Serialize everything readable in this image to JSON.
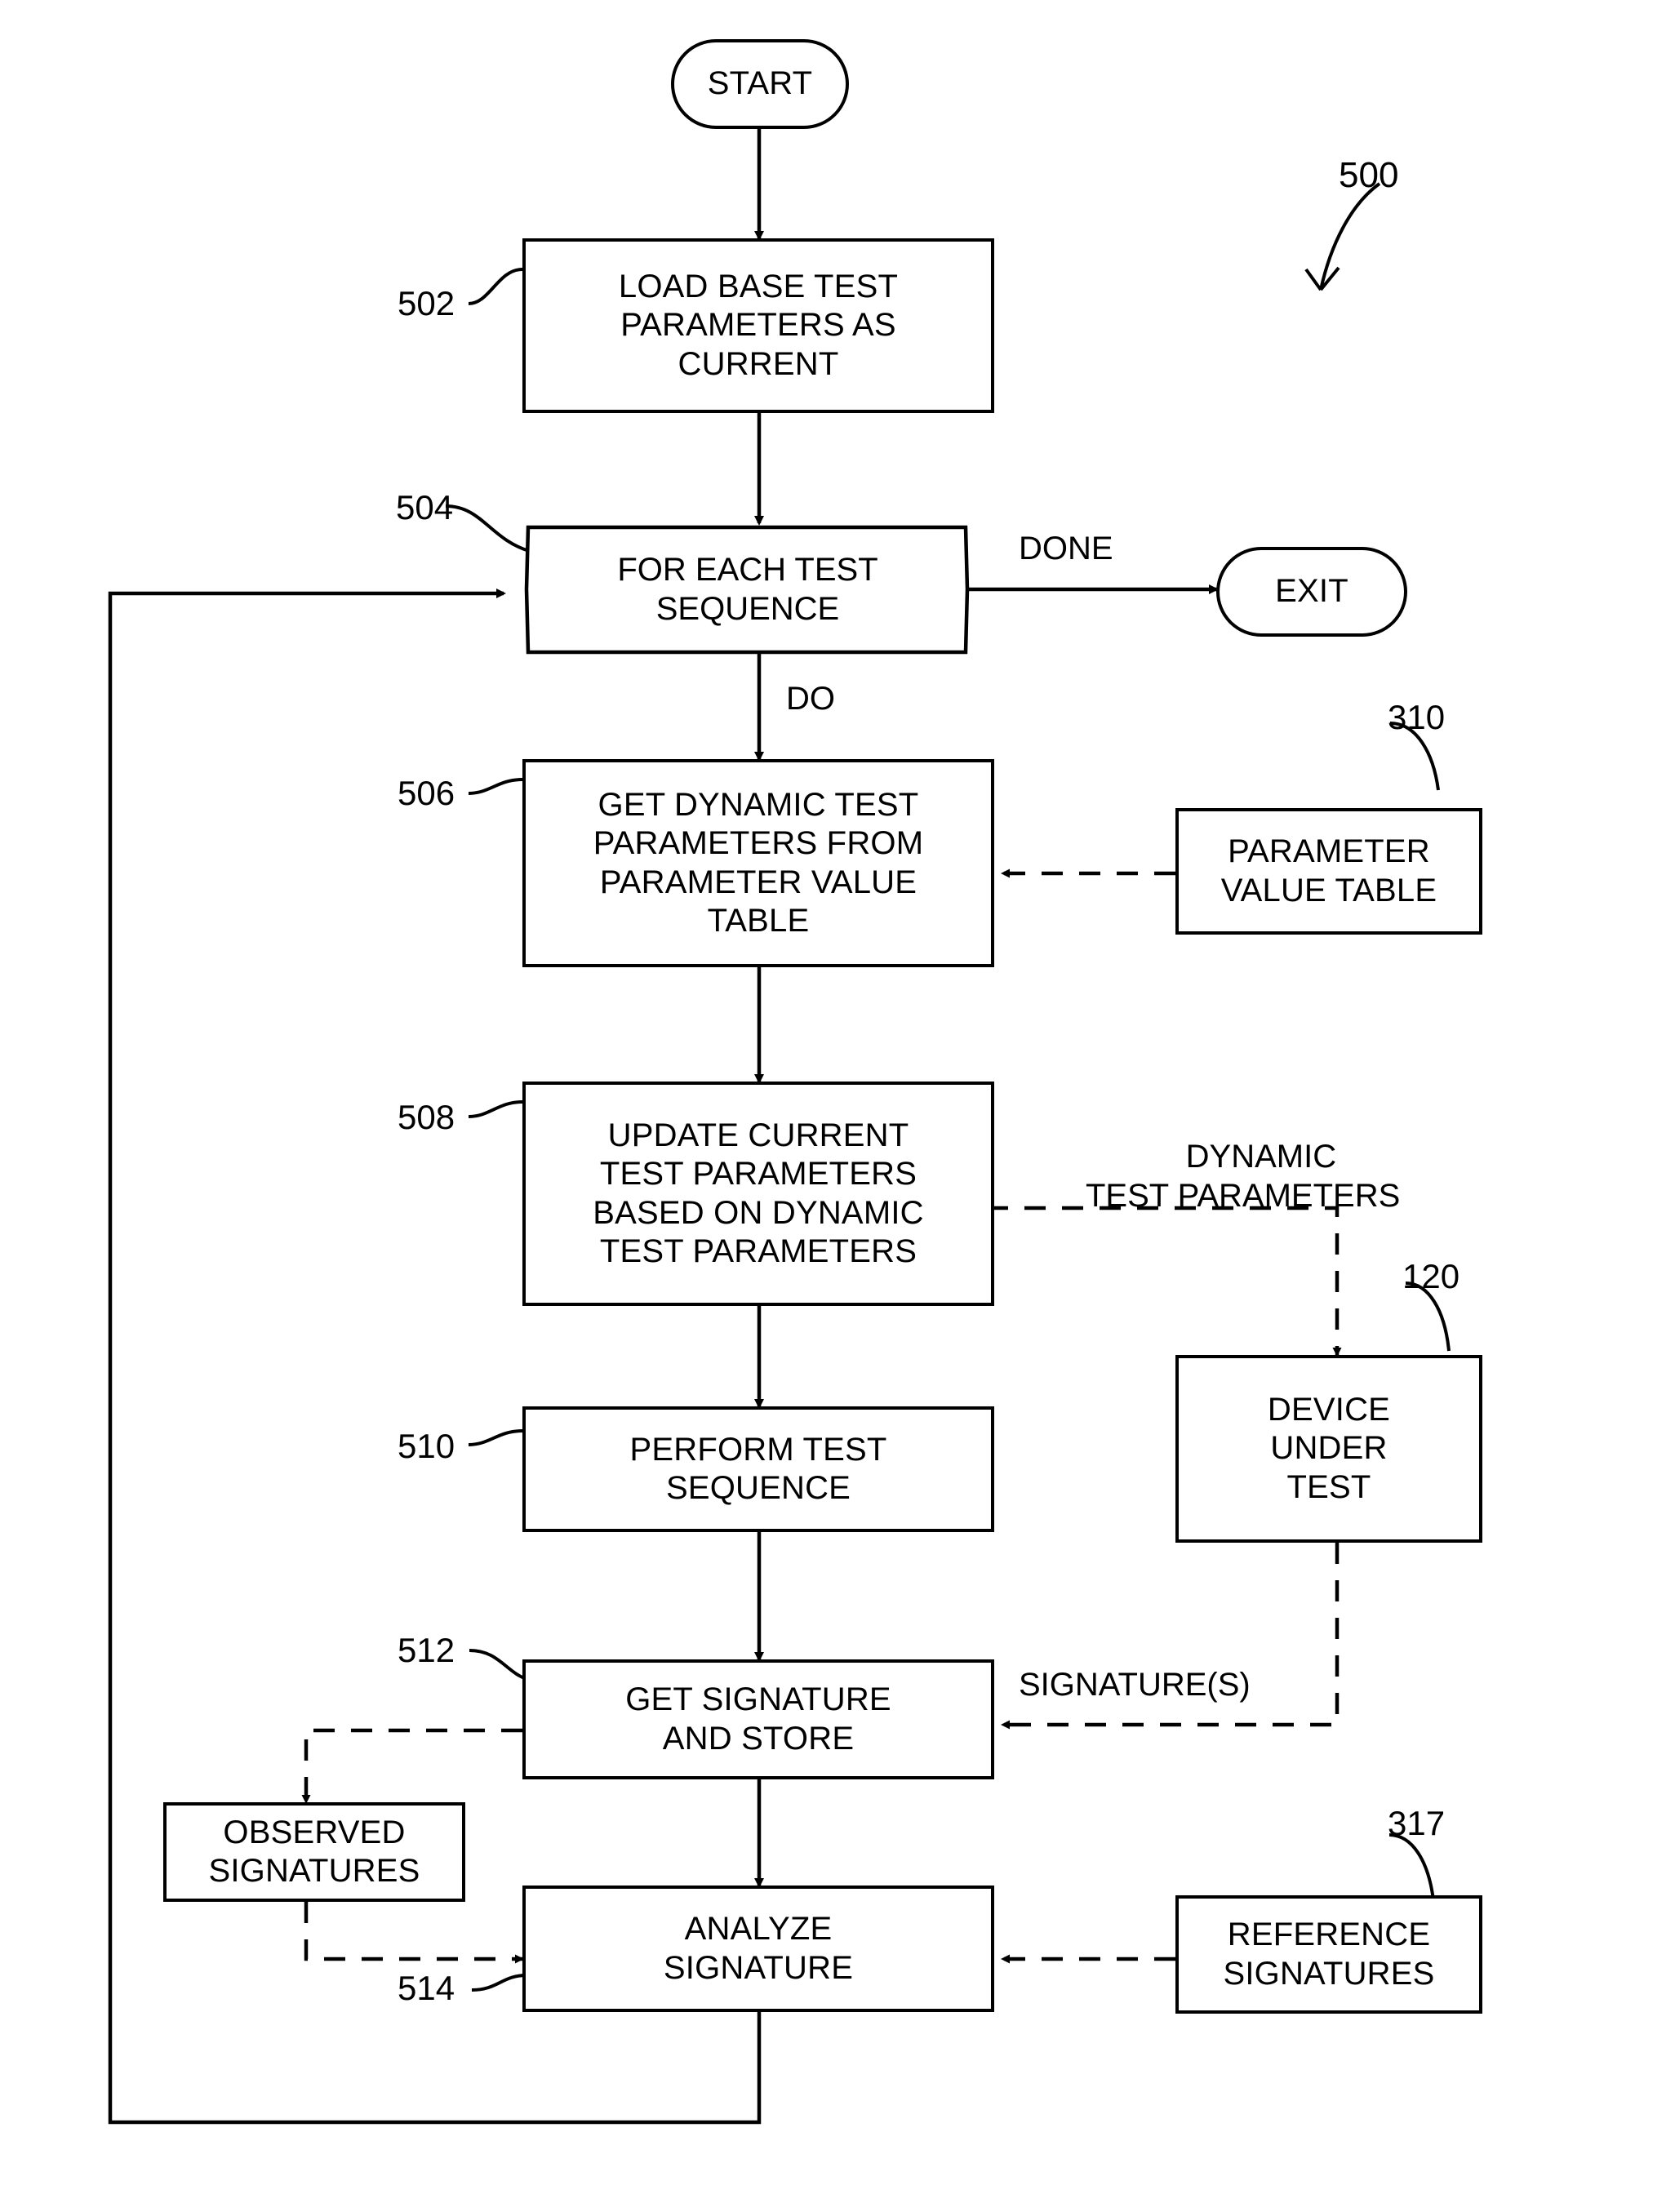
{
  "figure": {
    "id": "500",
    "type": "flowchart",
    "title": ""
  },
  "nodes": {
    "start": {
      "label": "START",
      "shape": "terminator",
      "ref": ""
    },
    "load_base": {
      "label": "LOAD BASE TEST\nPARAMETERS AS\nCURRENT",
      "shape": "process",
      "ref": "502"
    },
    "for_each": {
      "label": "FOR EACH TEST\nSEQUENCE",
      "shape": "hexagon",
      "ref": "504"
    },
    "exit": {
      "label": "EXIT",
      "shape": "terminator",
      "ref": ""
    },
    "get_dynamic": {
      "label": "GET DYNAMIC TEST\nPARAMETERS FROM\nPARAMETER VALUE\nTABLE",
      "shape": "process",
      "ref": "506"
    },
    "param_table": {
      "label": "PARAMETER\nVALUE TABLE",
      "shape": "data",
      "ref": "310"
    },
    "update_current": {
      "label": "UPDATE CURRENT\nTEST PARAMETERS\nBASED ON DYNAMIC\nTEST PARAMETERS",
      "shape": "process",
      "ref": "508"
    },
    "dut": {
      "label": "DEVICE\nUNDER\nTEST",
      "shape": "data",
      "ref": "120"
    },
    "perform_test": {
      "label": "PERFORM TEST\nSEQUENCE",
      "shape": "process",
      "ref": "510"
    },
    "get_signature": {
      "label": "GET SIGNATURE\nAND STORE",
      "shape": "process",
      "ref": "512"
    },
    "observed_signatures": {
      "label": "OBSERVED\nSIGNATURES",
      "shape": "data",
      "ref": ""
    },
    "analyze_signature": {
      "label": "ANALYZE\nSIGNATURE",
      "shape": "process",
      "ref": "514"
    },
    "reference_signatures": {
      "label": "REFERENCE\nSIGNATURES",
      "shape": "data",
      "ref": "317"
    }
  },
  "edge_labels": {
    "done": "DONE",
    "do": "DO",
    "dynamic_test_parameters": "DYNAMIC\nTEST PARAMETERS",
    "signatures": "SIGNATURE(S)"
  },
  "colors": {
    "stroke": "#000000",
    "fill": "#ffffff",
    "text": "#000000"
  }
}
